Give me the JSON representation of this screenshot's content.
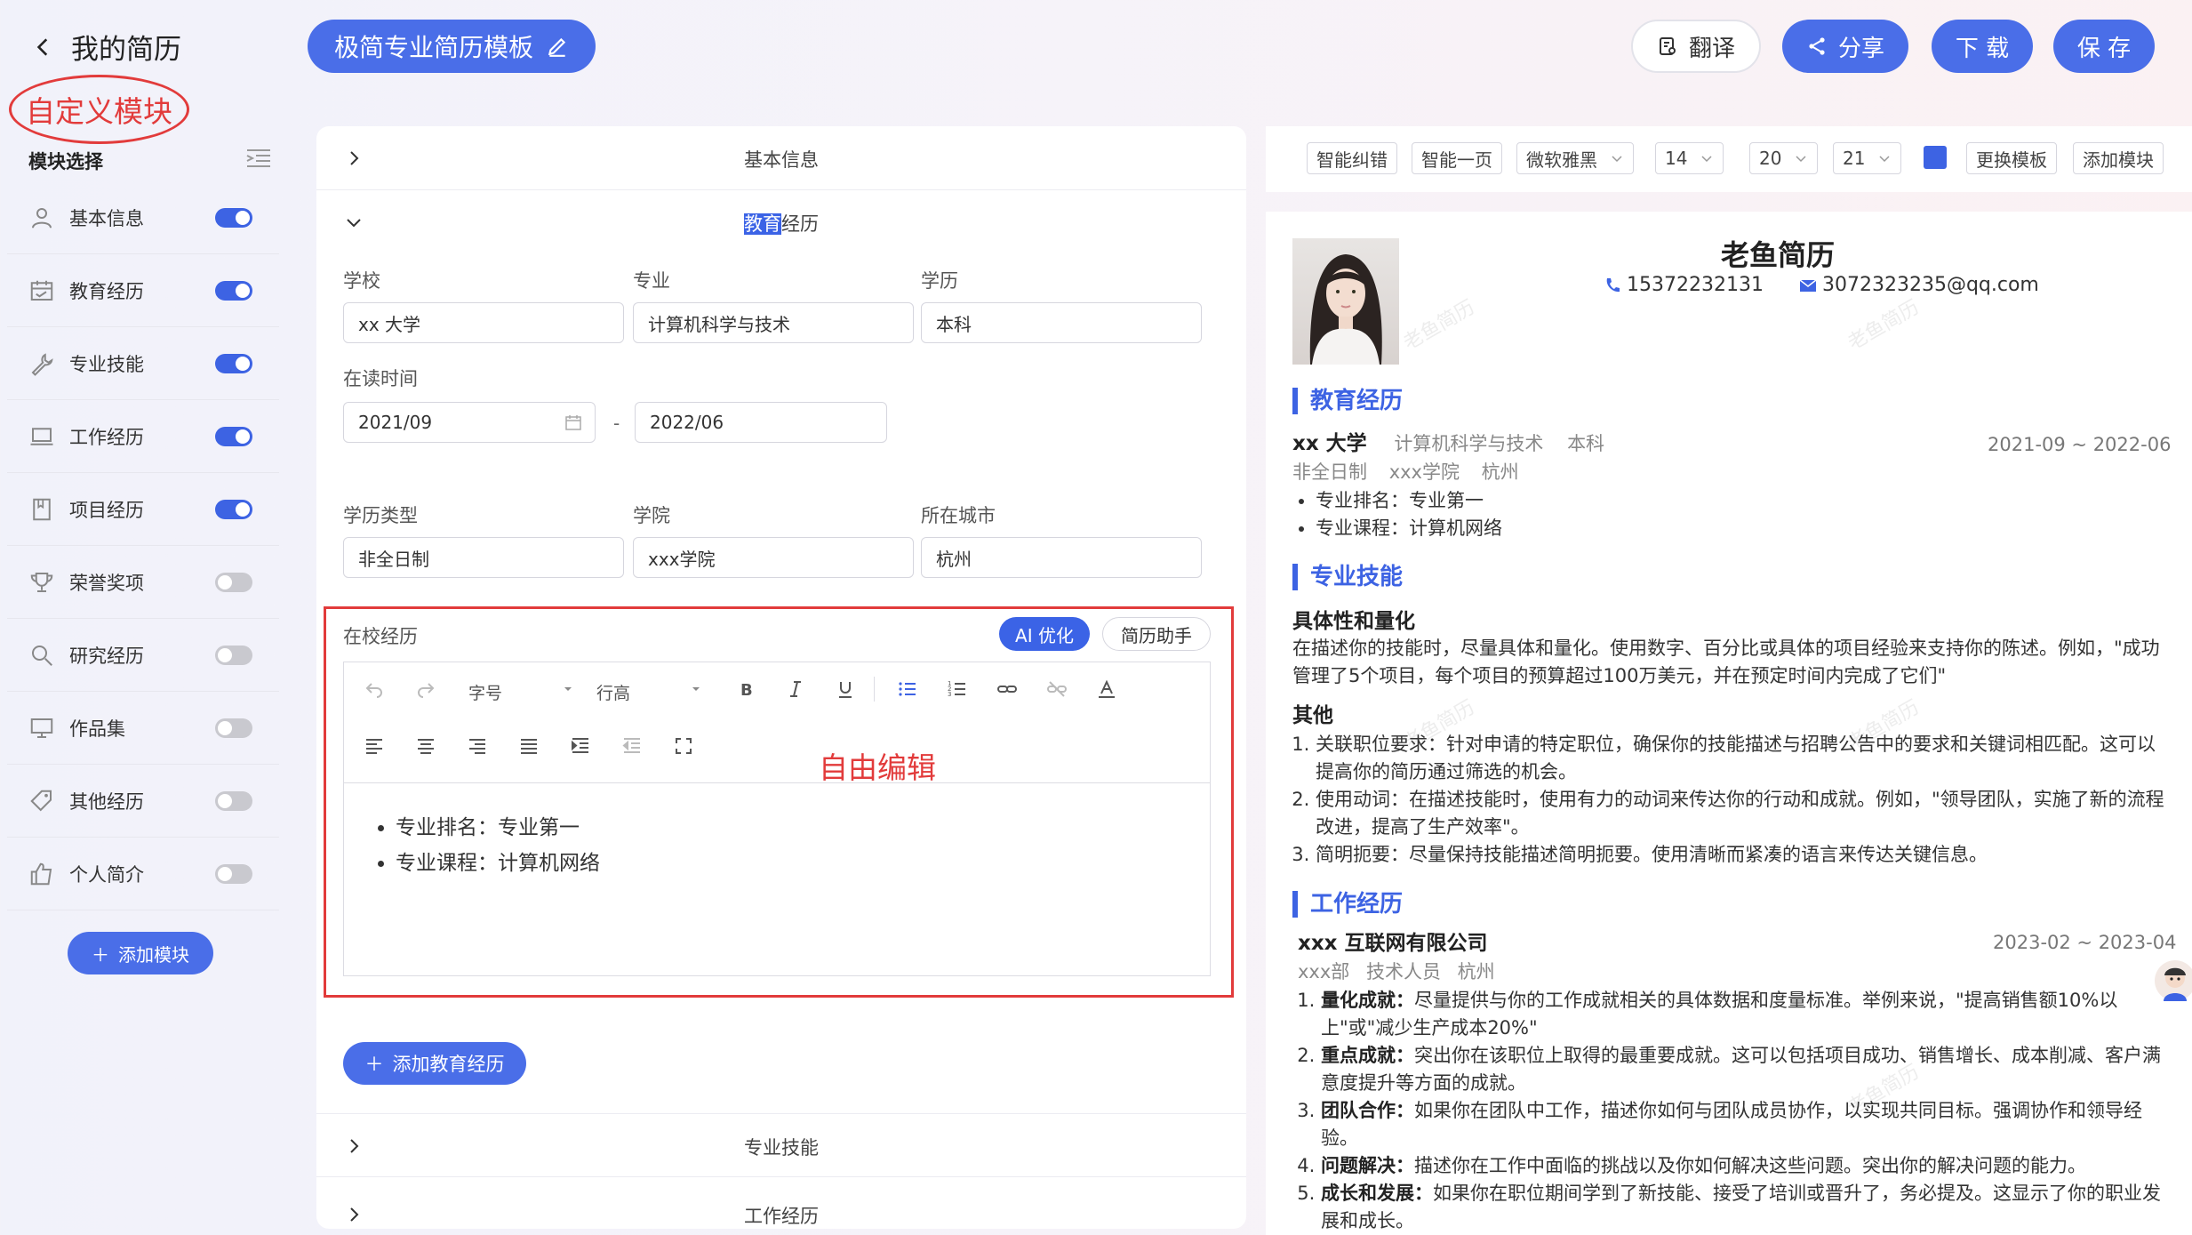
{
  "header": {
    "back_label": "我的简历",
    "template_name": "极简专业简历模板",
    "annotation_custom": "自定义模块",
    "buttons": {
      "translate": "翻译",
      "share": "分享",
      "download": "下 载",
      "save": "保 存"
    }
  },
  "sidebar": {
    "heading": "模块选择",
    "items": [
      {
        "label": "基本信息",
        "icon": "user-icon",
        "on": true
      },
      {
        "label": "教育经历",
        "icon": "calendar-icon",
        "on": true
      },
      {
        "label": "专业技能",
        "icon": "wrench-icon",
        "on": true
      },
      {
        "label": "工作经历",
        "icon": "laptop-icon",
        "on": true
      },
      {
        "label": "项目经历",
        "icon": "book-icon",
        "on": true
      },
      {
        "label": "荣誉奖项",
        "icon": "trophy-icon",
        "on": false
      },
      {
        "label": "研究经历",
        "icon": "search-icon",
        "on": false
      },
      {
        "label": "作品集",
        "icon": "monitor-icon",
        "on": false
      },
      {
        "label": "其他经历",
        "icon": "tag-icon",
        "on": false
      },
      {
        "label": "个人简介",
        "icon": "thumbs-up-icon",
        "on": false
      }
    ],
    "add_module": "添加模块"
  },
  "editor": {
    "section_basic": "基本信息",
    "section_edu_hl": "教育",
    "section_edu_rest": "经历",
    "labels": {
      "school": "学校",
      "major": "专业",
      "degree": "学历",
      "period": "在读时间",
      "edu_type": "学历类型",
      "college": "学院",
      "city": "所在城市",
      "on_school": "在校经历"
    },
    "values": {
      "school": "xx 大学",
      "major": "计算机科学与技术",
      "degree": "本科",
      "start": "2021/09",
      "end": "2022/06",
      "dash": "-",
      "edu_type": "非全日制",
      "college": "xxx学院",
      "city": "杭州"
    },
    "ai_btn": "AI 优化",
    "assist_btn": "简历助手",
    "toolbar": {
      "font_size": "字号",
      "line_height": "行高"
    },
    "annotation_free_edit": "自由编辑",
    "content": [
      "专业排名：专业第一",
      "专业课程：计算机网络"
    ],
    "add_edu": "添加教育经历",
    "section_skills": "专业技能",
    "section_work": "工作经历"
  },
  "preview_toolbar": {
    "smart_fix": "智能纠错",
    "one_page": "智能一页",
    "font": "微软雅黑",
    "size1": "14",
    "size2": "20",
    "size3": "21",
    "accent_color": "#3d63e3",
    "change_template": "更换模板",
    "add_module": "添加模块"
  },
  "resume": {
    "name": "老鱼简历",
    "phone": "15372232131",
    "email": "3072323235@qq.com",
    "watermark": "老鱼简历",
    "edu_title": "教育经历",
    "edu_school": "xx 大学",
    "edu_major": "计算机科学与技术",
    "edu_degree": "本科",
    "edu_date": "2021-09 ~ 2022-06",
    "edu_type": "非全日制",
    "edu_college": "xxx学院",
    "edu_city": "杭州",
    "edu_items": [
      "专业排名：专业第一",
      "专业课程：计算机网络"
    ],
    "skills_title": "专业技能",
    "skills_sub1": "具体性和量化",
    "skills_p1_line1": "在描述你的技能时，尽量具体和量化。使用数字、百分比或具体的项目经验来支持你的陈述。例如，\"成功",
    "skills_p1_line2": "管理了5个项目，每个项目的预算超过100万美元，并在预定时间内完成了它们\"",
    "skills_sub2": "其他",
    "skills_items": [
      [
        "关联职位要求：针对申请的特定职位，确保你的技能描述与招聘公告中的要求和关键词相匹配。这可以",
        "提高你的简历通过筛选的机会。"
      ],
      [
        "使用动词：在描述技能时，使用有力的动词来传达你的行动和成就。例如，\"领导团队，实施了新的流程",
        "改进，提高了生产效率\"。"
      ],
      [
        "简明扼要：尽量保持技能描述简明扼要。使用清晰而紧凑的语言来传达关键信息。"
      ]
    ],
    "work_title": "工作经历",
    "work_company": "xxx 互联网有限公司",
    "work_date": "2023-02 ~ 2023-04",
    "work_dept": "xxx部",
    "work_role": "技术人员",
    "work_city": "杭州",
    "work_items": [
      {
        "head": "量化成就：",
        "l1": "尽量提供与你的工作成就相关的具体数据和度量标准。举例来说，\"提高销售额10%以",
        "l2": "上\"或\"减少生产成本20%\""
      },
      {
        "head": "重点成就：",
        "l1": "突出你在该职位上取得的最重要成就。这可以包括项目成功、销售增长、成本削减、客户满",
        "l2": "意度提升等方面的成就。"
      },
      {
        "head": "团队合作：",
        "l1": "如果你在团队中工作，描述你如何与团队成员协作，以实现共同目标。强调协作和领导经",
        "l2": "验。"
      },
      {
        "head": "问题解决：",
        "l1": "描述你在工作中面临的挑战以及你如何解决这些问题。突出你的解决问题的能力。",
        "l2": ""
      },
      {
        "head": "成长和发展：",
        "l1": "如果你在职位期间学到了新技能、接受了培训或晋升了，务必提及。这显示了你的职业发",
        "l2": "展和成长。"
      }
    ]
  }
}
